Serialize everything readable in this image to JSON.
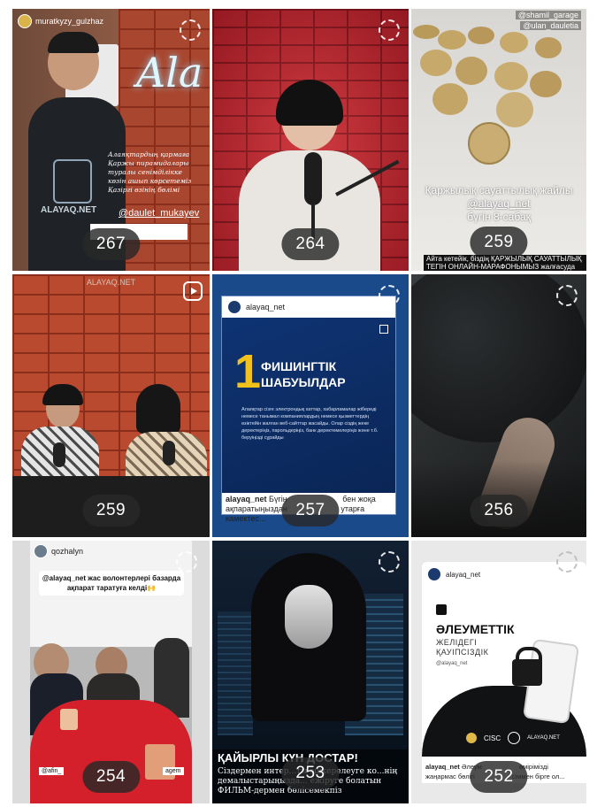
{
  "tiles": [
    {
      "views": "267",
      "username": "muratkyzy_gulzhaz",
      "neon": "Ala",
      "caption_lines": [
        "Алаяқтардың қармаға",
        "Қаржы пирамидалары",
        "туралы сенімділікке",
        "көзін ашып көрсетеміз",
        "Қазіргі өзінің бөлімі"
      ],
      "hoodie_text": "ALAYAQ.NET",
      "mention": "@daulet_mukayev"
    },
    {
      "views": "264"
    },
    {
      "views": "259",
      "top_tag1": "@shamil_garage",
      "top_tag2": "@ulan_dauletia",
      "caption1": "Қаржылық сауаттылық жайлы",
      "caption2": "@alayaq_net",
      "caption3": "бүгін 8-сабақ",
      "bottom_banner": "Айта кетейік, біздің ҚАРЖЫЛЫҚ САУАТТЫЛЫҚ ТЕГІН ОНЛАЙН-МАРАФОНЫМЫЗ жалғасуда"
    },
    {
      "views": "259",
      "wall_text": "ALAYAQ.NET"
    },
    {
      "views": "257",
      "username": "alayaq_net",
      "number": "1",
      "title_line1": "ФИШИНГТІК",
      "title_line2": "ШАБУЫЛДАР",
      "body": "Алаяқтар сізге электрондық хаттар, хабарламалар жібереді немесе танымал компаниялардың немесе қызметтердің өзіктейін жалған веб-сайттар жасайды. Олар сіздің жеке деректеріңіз, парольдеріңіз, банк деректемелеріңіз және т.б. беруіңізді сұрайды",
      "footer_user": "alayaq_net",
      "footer_text1": "Бүгін",
      "footer_text2": "бен жоқа",
      "footer_text3": "ақпаратыңыздан",
      "footer_text4": "утарға камектес..."
    },
    {
      "views": "256"
    },
    {
      "views": "254",
      "username": "qozhalyn",
      "caption": "@alayaq_net жас волонтерлері базарда ақпарат таратуға келді🙌",
      "tag1": "@afin_",
      "tag2": "agem"
    },
    {
      "views": "253",
      "title": "ҚАЙЫРЛЫ КҮН ДОСТАР!",
      "body": "Сіздермен интер...ты эшкерелеуге ко...нің демалыстарыңызда... ежіруге болатын ФИЛЬМ-дермен бөлісемекпіз"
    },
    {
      "views": "252",
      "username": "alayaq_net",
      "title": "ӘЛЕУМЕТТІК",
      "subtitle1": "ЖЕЛІДЕГІ",
      "subtitle2": "ҚАУІПСІЗДІК",
      "handle": "@alayaq_net",
      "logo_cisc": "CISC",
      "logo_alayaq": "ALAYAQ.NET",
      "footer_user": "alayaq_net",
      "footer_text1": "Әлеум",
      "footer_text2": "өмірімізді",
      "footer_text3": "жаңармас бөлігі",
      "footer_text4": "сіммен бірге ол..."
    }
  ]
}
